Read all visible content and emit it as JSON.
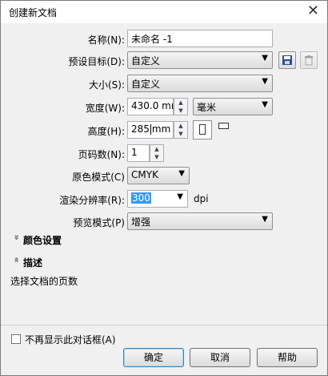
{
  "window": {
    "title": "创建新文档",
    "close_glyph": "✕"
  },
  "form": {
    "name_label": "名称(N):",
    "name_value": "未命名 -1",
    "preset_label": "预设目标(D):",
    "preset_value": "自定义",
    "size_label": "大小(S):",
    "size_value": "自定义",
    "width_label": "宽度(W):",
    "width_value": "430.0 mm",
    "unit_value": "毫米",
    "height_label": "高度(H):",
    "height_value_before": "285",
    "height_value_after": "mm",
    "pages_label": "页码数(N):",
    "pages_value": "1",
    "color_mode_label": "原色模式(C)",
    "color_mode_value": "CMYK",
    "resolution_label": "渲染分辨率(R):",
    "resolution_value": "300",
    "resolution_unit": "dpi",
    "preview_label": "预览模式(P)",
    "preview_value": "增强"
  },
  "sections": {
    "color_settings": "颜色设置",
    "color_settings_chev": "»",
    "description": "描述",
    "description_chev": "«",
    "description_text": "选择文档的页数"
  },
  "footer": {
    "dont_show_label": "不再显示此对话框(A)",
    "ok_label": "确定",
    "cancel_label": "取消",
    "help_label": "帮助"
  },
  "icons": {
    "save": "save-preset-icon",
    "delete": "delete-preset-icon",
    "portrait": "portrait-icon",
    "landscape": "landscape-icon"
  }
}
